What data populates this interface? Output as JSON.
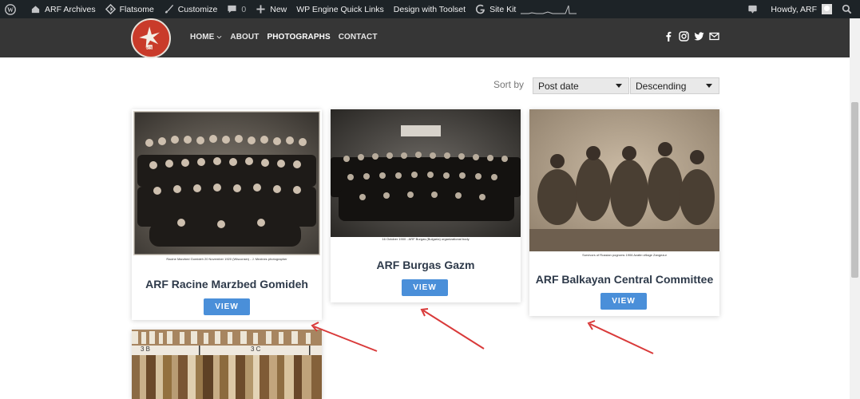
{
  "admin_bar": {
    "items": [
      {
        "label": "ARF Archives",
        "icon": "home-icon"
      },
      {
        "label": "Flatsome",
        "icon": "flatsome-icon"
      },
      {
        "label": "Customize",
        "icon": "brush-icon"
      },
      {
        "label": "0",
        "icon": "comment-icon"
      },
      {
        "label": "New",
        "icon": "plus-icon"
      },
      {
        "label": "WP Engine Quick Links"
      },
      {
        "label": "Design with Toolset"
      },
      {
        "label": "Site Kit",
        "icon": "google-icon"
      }
    ],
    "howdy": "Howdy, ARF"
  },
  "nav": {
    "items": [
      {
        "label": "HOME",
        "has_dropdown": true
      },
      {
        "label": "ABOUT"
      },
      {
        "label": "PHOTOGRAPHS",
        "active": true
      },
      {
        "label": "CONTACT"
      }
    ]
  },
  "social_icons": [
    "facebook-icon",
    "instagram-icon",
    "twitter-icon",
    "mail-icon"
  ],
  "sort": {
    "label": "Sort by",
    "field_value": "Post date",
    "order_value": "Descending"
  },
  "cards": [
    {
      "title": "ARF Racine Marzbed Gomideh",
      "caption": "Racine Marzbed Gomideh 20 November 1920 (Wisconsin) - J. Mezines photographer",
      "button": "VIEW"
    },
    {
      "title": "ARF Burgas Gazm",
      "caption": "16 October 1900 - ARF Burgas (Bulgaria) organizational body",
      "button": "VIEW"
    },
    {
      "title": "ARF Balkayan Central Committee",
      "caption": "Survivors of Russian pogroms 1906 Azatin village Zangezur",
      "button": "VIEW"
    }
  ],
  "books_labels": [
    "3 B",
    "3 C"
  ],
  "colors": {
    "admin_bar_bg": "#1d2327",
    "header_bg": "#363636",
    "button": "#4a8fd9",
    "title": "#2e3a4a",
    "annotation_arrow": "#d93a3a"
  }
}
